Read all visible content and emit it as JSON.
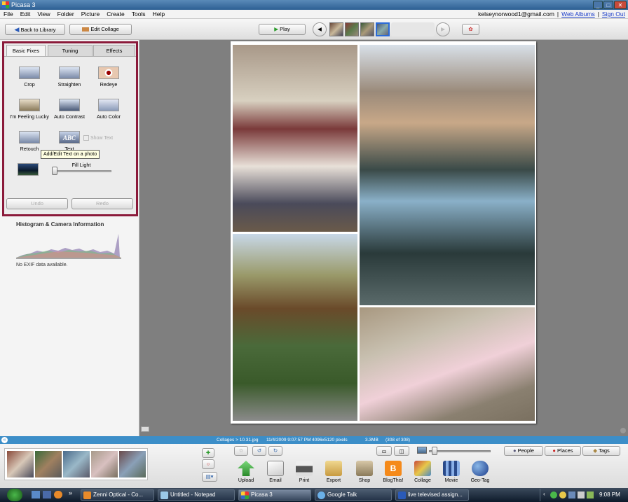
{
  "window": {
    "title": "Picasa 3"
  },
  "menu": [
    "File",
    "Edit",
    "View",
    "Folder",
    "Picture",
    "Create",
    "Tools",
    "Help"
  ],
  "account": {
    "email": "kelseynorwood1@gmail.com",
    "web_albums": "Web Albums",
    "sign_out": "Sign Out"
  },
  "toolbar": {
    "back": "Back to Library",
    "edit_collage": "Edit Collage",
    "play": "Play"
  },
  "tabs": [
    "Basic Fixes",
    "Tuning",
    "Effects"
  ],
  "tools": [
    "Crop",
    "Straighten",
    "Redeye",
    "I'm Feeling Lucky",
    "Auto Contrast",
    "Auto Color",
    "Retouch",
    "Text"
  ],
  "show_text": "Show Text",
  "tooltip": "Add/Edit Text on a photo",
  "fill_light": "Fill Light",
  "fill_light_value": 0,
  "undo": "Undo",
  "redo": "Redo",
  "histogram": {
    "title": "Histogram & Camera Information",
    "exif": "No EXIF data available."
  },
  "status": {
    "path": "Collages > 10.31.jpg",
    "date": "11/4/2009 9:07:57 PM",
    "dims": "4096x5120 pixels",
    "size": "3.3MB",
    "count": "(308 of 308)"
  },
  "tray_tabs": [
    "People",
    "Places",
    "Tags"
  ],
  "actions": [
    "Upload",
    "Email",
    "Print",
    "Export",
    "Shop",
    "BlogThis!",
    "Collage",
    "Movie",
    "Geo-Tag"
  ],
  "taskbar": [
    "Zenni Optical - Co...",
    "Untitled - Notepad",
    "Picasa 3",
    "Google Talk",
    "live televised assign..."
  ],
  "clock": "9:08 PM",
  "colors": {
    "accent_border": "#8b1a3a",
    "status_bar": "#3c8ec8"
  }
}
